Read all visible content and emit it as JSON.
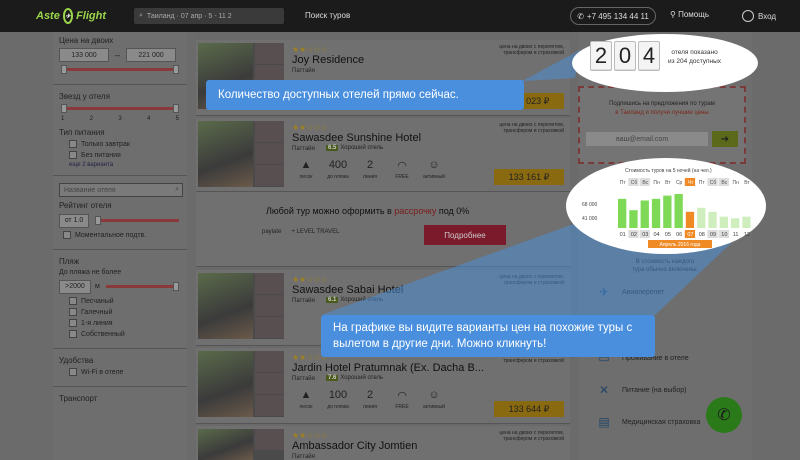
{
  "header": {
    "logo": "Aste",
    "logo2": "Flight",
    "search_text": "Таиланд · 07 апр · 5 - 11 2",
    "tours_menu": "Поиск туров",
    "phone": "+7 495 134 44 11",
    "help": "Помощь",
    "login": "Вход"
  },
  "sidebar": {
    "price_title": "Цена на двоих",
    "price_min": "133 000",
    "price_max": "221 000",
    "stars_title": "Звезд у отеля",
    "stars": [
      "1",
      "2",
      "3",
      "4",
      "5"
    ],
    "food_title": "Тип питания",
    "food": [
      "Только завтрак",
      "Без питания"
    ],
    "more": "еще 2 варианта",
    "hotel_search_placeholder": "Название отеля",
    "rating_title": "Рейтинг отеля",
    "rating_from": "от 1.0",
    "instant_confirm": "Моментальное подтв.",
    "beach_title": "Пляж",
    "beach_distance": "До пляжа не более",
    "beach_value": ">2000",
    "beach_unit": "м",
    "beach_types": [
      "Песчаный",
      "Галечный",
      "1-я линия",
      "Собственный"
    ],
    "amenities_title": "Удобства",
    "wifi": "Wi-Fi в отеле",
    "transport_title": "Транспорт"
  },
  "hotels": [
    {
      "stars": "★★☆☆☆",
      "name": "Joy Residence",
      "location": "Паттайя",
      "note": "цена на двоих с перелетом, трансфером и страховкой",
      "price": "133 023 ₽"
    },
    {
      "stars": "★★☆☆☆",
      "name": "Sawasdee Sunshine Hotel",
      "location": "Паттайя",
      "rating": "6.5",
      "rating_text": "Хороший отель",
      "note": "цена на двоих с перелетом, трансфером и страховкой",
      "amenities": [
        {
          "value": "",
          "label": "песок"
        },
        {
          "value": "400",
          "label": "до пляжа"
        },
        {
          "value": "2",
          "label": "линия"
        },
        {
          "value": "",
          "label": "FREE"
        },
        {
          "value": "",
          "label": "активный"
        }
      ],
      "price": "133 161 ₽"
    },
    {
      "stars": "★★☆☆☆",
      "name": "Sawasdee Sabai Hotel",
      "location": "Паттайя",
      "rating": "6.1",
      "rating_text": "Хороший отель",
      "note": "цена на двоих с перелетом, трансфером и страховкой"
    },
    {
      "stars": "★★☆☆☆",
      "name": "Jardin Hotel Pratumnak (Ex. Dacha B...",
      "location": "Паттайя",
      "rating": "7.6",
      "rating_text": "Хороший отель",
      "note": "цена на двоих с перелетом, трансфером и страховкой",
      "amenities": [
        {
          "value": "",
          "label": "песок"
        },
        {
          "value": "100",
          "label": "до пляжа"
        },
        {
          "value": "2",
          "label": "линия"
        },
        {
          "value": "",
          "label": "FREE"
        },
        {
          "value": "",
          "label": "активный"
        }
      ],
      "price": "133 644 ₽"
    },
    {
      "stars": "★★☆☆☆",
      "name": "Ambassador City Jomtien",
      "location": "Паттайя",
      "note": "цена на двоих с перелетом, трансфером и страховкой"
    }
  ],
  "promo": {
    "text_before": "Любой тур можно оформить в ",
    "text_link": "рассрочку",
    "text_after": " под 0%",
    "logo1": "paylate",
    "logo2": "+ LEVEL TRAVEL",
    "button": "Подробнее"
  },
  "counter": {
    "digits": [
      "2",
      "0",
      "4"
    ],
    "line1": "отеля показано",
    "line2": "из 204 доступных"
  },
  "subscribe": {
    "line1": "Подпишись на предложения по турам",
    "line2_link": "в Таиланд",
    "line2_rest": " и получи лучшие цены",
    "email_placeholder": "ваш@email.com",
    "go": "➜"
  },
  "chart_data": {
    "type": "bar",
    "title": "Стоимость туров на 5 ночей (на чел.)",
    "weekdays": [
      "Пт",
      "Сб",
      "Вс",
      "Пн",
      "Вт",
      "Ср",
      "Чт",
      "Пт",
      "Сб",
      "Вс",
      "Пн",
      "Вт"
    ],
    "categories": [
      "01",
      "02",
      "03",
      "04",
      "05",
      "06",
      "07",
      "08",
      "09",
      "10",
      "11",
      "12"
    ],
    "values": [
      66000,
      52000,
      64000,
      66000,
      70000,
      72000,
      50000,
      55000,
      50000,
      44000,
      42000,
      44000
    ],
    "selected_index": 6,
    "yticks": [
      "68 000",
      "41 000"
    ],
    "month_label": "Апрель 2016 года",
    "colors": {
      "bar": "#7ed957",
      "bar_light": "#cfeebd",
      "selected": "#f08a24",
      "weekend": "#bbbbbb"
    }
  },
  "included": {
    "title_line1": "В стоимость каждого",
    "title_line2": "тура обычно включены:",
    "items": [
      {
        "icon": "plane-icon",
        "label": "Авиаперелет"
      },
      {
        "icon": "bed-icon",
        "label": "Проживание в отеле"
      },
      {
        "icon": "food-icon",
        "label": "Питание (на выбор)"
      },
      {
        "icon": "insurance-icon",
        "label": "Медицинская страховка"
      }
    ]
  },
  "tips": {
    "tip1": "Количество доступных отелей прямо сейчас.",
    "tip2": "На графике вы видите варианты цен на похожие туры с вылетом в другие дни. Можно кликнуть!"
  }
}
